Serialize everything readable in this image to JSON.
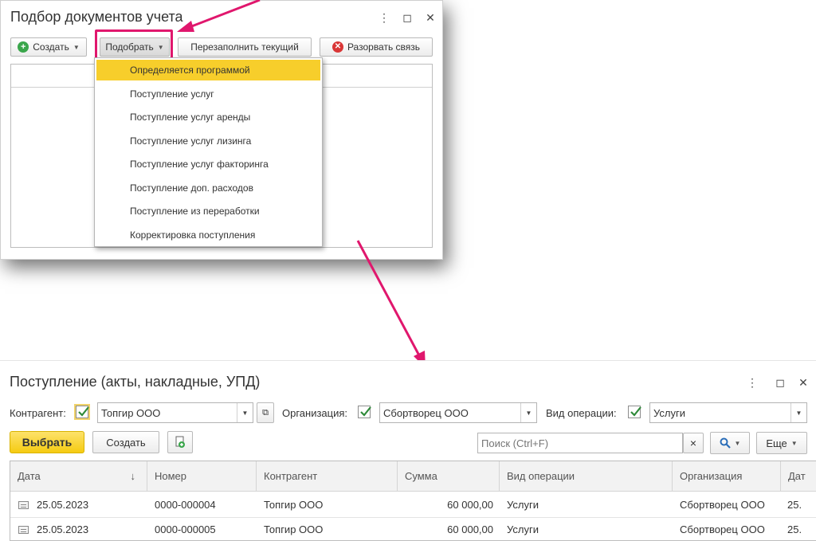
{
  "window1": {
    "title": "Подбор документов учета",
    "controls": {
      "more": "⋮",
      "maximize": "◻",
      "close": "✕"
    },
    "toolbar": {
      "create_label": "Создать",
      "pick_label": "Подобрать",
      "refill_label": "Перезаполнить текущий",
      "unlink_label": "Разорвать связь"
    },
    "dropdown": {
      "selected_index": 0,
      "items": [
        "Определяется программой",
        "Поступление услуг",
        "Поступление услуг аренды",
        "Поступление услуг лизинга",
        "Поступление услуг факторинга",
        "Поступление доп. расходов",
        "Поступление из переработки",
        "Корректировка поступления"
      ]
    }
  },
  "window2": {
    "title": "Поступление (акты, накладные, УПД)",
    "controls": {
      "more": "⋮",
      "maximize": "◻",
      "close": "✕"
    },
    "filters": {
      "counterparty_label": "Контрагент:",
      "counterparty_checked": true,
      "counterparty_value": "Топгир ООО",
      "organization_label": "Организация:",
      "organization_checked": true,
      "organization_value": "Сбортворец ООО",
      "operation_label": "Вид операции:",
      "operation_checked": true,
      "operation_value": "Услуги"
    },
    "toolbar": {
      "select_label": "Выбрать",
      "create_label": "Создать",
      "search_placeholder": "Поиск (Ctrl+F)",
      "clear_label": "×",
      "more_label": "Еще"
    },
    "table": {
      "sort_indicator": "↓",
      "columns": [
        "Дата",
        "Номер",
        "Контрагент",
        "Сумма",
        "Вид операции",
        "Организация",
        "Дат"
      ],
      "rows": [
        {
          "date": "25.05.2023",
          "number": "0000-000004",
          "counterparty": "Топгир ООО",
          "sum": "60 000,00",
          "operation": "Услуги",
          "organization": "Сбортворец ООО",
          "date2": "25."
        },
        {
          "date": "25.05.2023",
          "number": "0000-000005",
          "counterparty": "Топгир ООО",
          "sum": "60 000,00",
          "operation": "Услуги",
          "organization": "Сбортворец ООО",
          "date2": "25."
        }
      ]
    }
  },
  "colors": {
    "highlight": "#e0176d",
    "arrow": "#e0176d",
    "selected_item": "#f7ce2b",
    "primary_button": "#f5cb12"
  }
}
